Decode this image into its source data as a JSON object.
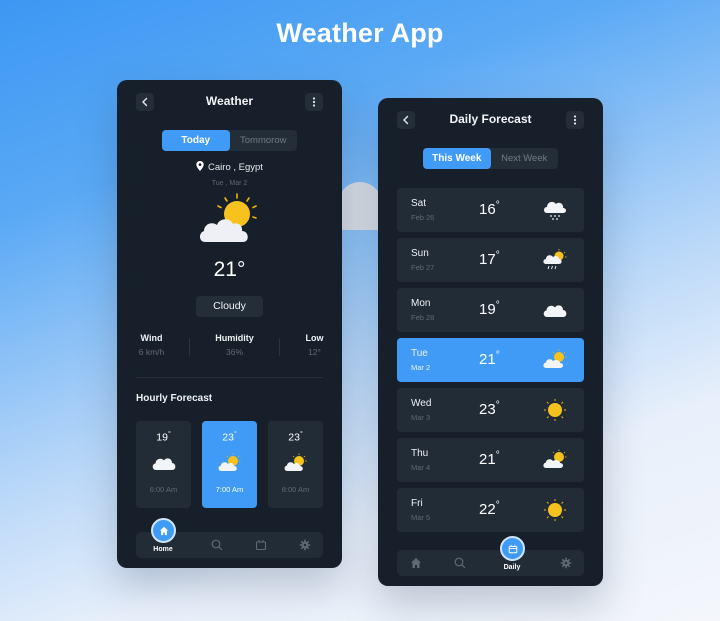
{
  "header": {
    "title": "Weather App"
  },
  "colors": {
    "accent": "#3f9bf6",
    "panel": "#17202a",
    "card": "#222c37",
    "sun": "#f5c518"
  },
  "today_screen": {
    "title": "Weather",
    "back_icon": "chevron-left-icon",
    "menu_icon": "more-vertical-icon",
    "tabs": [
      {
        "label": "Today",
        "active": true
      },
      {
        "label": "Tommorow",
        "active": false
      }
    ],
    "location": "Cairo , Egypt",
    "date": "Tue , Mar 2",
    "temperature": "21°",
    "condition": "Cloudy",
    "condition_icon": "partly-cloudy-icon",
    "stats": [
      {
        "label": "Wind",
        "value": "6 km/h"
      },
      {
        "label": "Humidity",
        "value": "36%"
      },
      {
        "label": "Low",
        "value": "12°"
      }
    ],
    "hourly_title": "Hourly Forecast",
    "hourly": [
      {
        "temp": "19",
        "icon": "cloud-icon",
        "time": "6:00 Am",
        "active": false
      },
      {
        "temp": "23",
        "icon": "partly-cloudy-icon",
        "time": "7:00 Am",
        "active": true
      },
      {
        "temp": "23",
        "icon": "partly-cloudy-icon",
        "time": "8:00 Am",
        "active": false
      }
    ],
    "nav": [
      {
        "icon": "home-icon",
        "label": "Home",
        "active": true
      },
      {
        "icon": "search-icon",
        "label": "",
        "active": false
      },
      {
        "icon": "calendar-icon",
        "label": "",
        "active": false
      },
      {
        "icon": "gear-icon",
        "label": "",
        "active": false
      }
    ]
  },
  "daily_screen": {
    "title": "Daily Forecast",
    "back_icon": "chevron-left-icon",
    "menu_icon": "more-vertical-icon",
    "tabs": [
      {
        "label": "This Week",
        "active": true
      },
      {
        "label": "Next Week",
        "active": false
      }
    ],
    "days": [
      {
        "day": "Sat",
        "date": "Feb 26",
        "temp": "16",
        "icon": "snow-cloud-icon",
        "active": false
      },
      {
        "day": "Sun",
        "date": "Feb 27",
        "temp": "17",
        "icon": "sun-rain-cloud-icon",
        "active": false
      },
      {
        "day": "Mon",
        "date": "Feb 28",
        "temp": "19",
        "icon": "cloud-icon",
        "active": false
      },
      {
        "day": "Tue",
        "date": "Mar 2",
        "temp": "21",
        "icon": "partly-cloudy-icon",
        "active": true
      },
      {
        "day": "Wed",
        "date": "Mar 3",
        "temp": "23",
        "icon": "sun-icon",
        "active": false
      },
      {
        "day": "Thu",
        "date": "Mar 4",
        "temp": "21",
        "icon": "partly-cloudy-icon",
        "active": false
      },
      {
        "day": "Fri",
        "date": "Mar 5",
        "temp": "22",
        "icon": "sun-icon",
        "active": false
      }
    ],
    "nav": [
      {
        "icon": "home-icon",
        "label": "",
        "active": false
      },
      {
        "icon": "search-icon",
        "label": "",
        "active": false
      },
      {
        "icon": "calendar-icon",
        "label": "Daily",
        "active": true
      },
      {
        "icon": "gear-icon",
        "label": "",
        "active": false
      }
    ]
  }
}
